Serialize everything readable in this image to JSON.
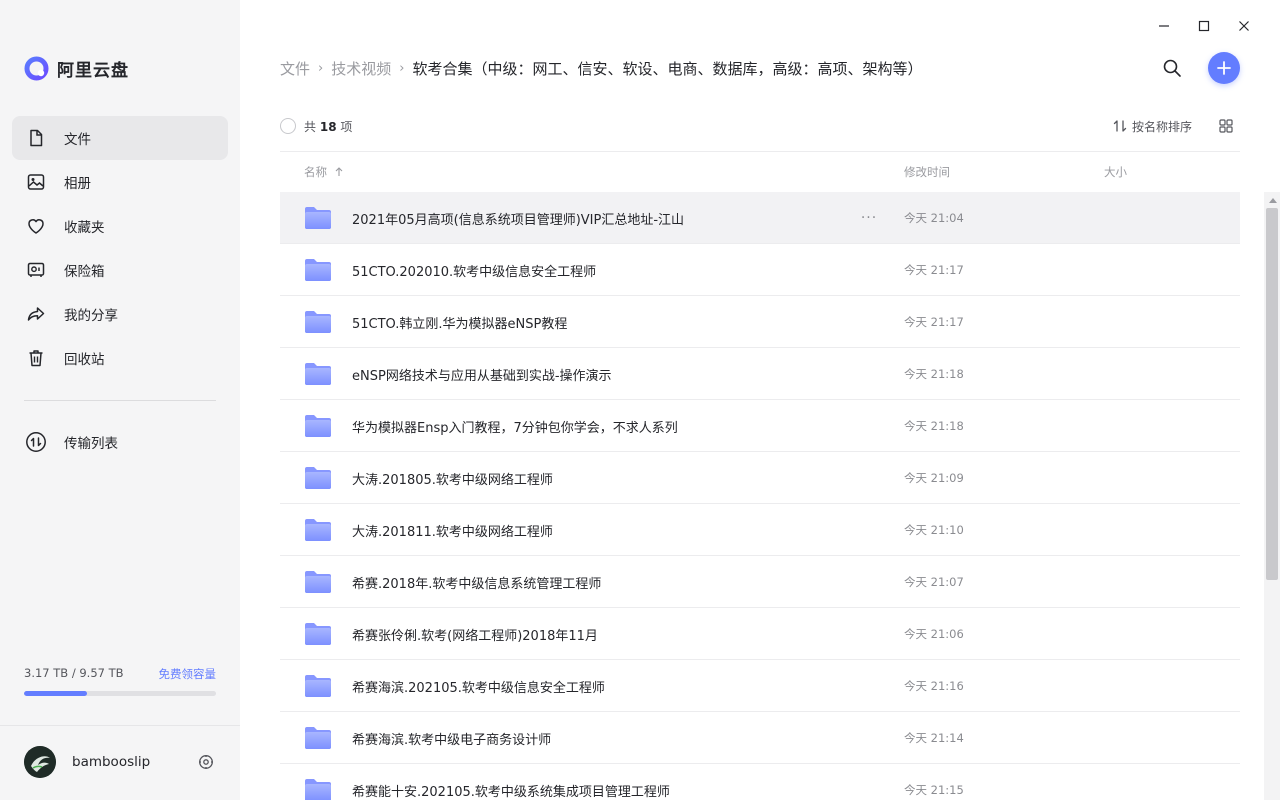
{
  "app": {
    "name": "阿里云盘",
    "accent": "#637dff"
  },
  "sidebar": {
    "nav": [
      {
        "label": "文件",
        "icon": "file-icon",
        "active": true
      },
      {
        "label": "相册",
        "icon": "photo-icon"
      },
      {
        "label": "收藏夹",
        "icon": "heart-icon"
      },
      {
        "label": "保险箱",
        "icon": "safe-icon"
      },
      {
        "label": "我的分享",
        "icon": "share-icon"
      },
      {
        "label": "回收站",
        "icon": "trash-icon"
      }
    ],
    "transfer": {
      "label": "传输列表",
      "icon": "transfer-icon"
    },
    "quota": {
      "used_text": "3.17 TB / 9.57 TB",
      "used_fraction": 0.33,
      "link": "免费领容量"
    },
    "user": {
      "name": "bambooslip"
    }
  },
  "breadcrumb": {
    "items": [
      "文件",
      "技术视频"
    ],
    "current": "软考合集（中级：网工、信安、软设、电商、数据库，高级：高项、架构等）"
  },
  "toolbar": {
    "count_prefix": "共",
    "count": "18",
    "count_suffix": "项",
    "sort_label": "按名称排序"
  },
  "table": {
    "headers": {
      "name": "名称",
      "time": "修改时间",
      "size": "大小"
    },
    "rows": [
      {
        "name": "2021年05月高项(信息系统项目管理师)VIP汇总地址-江山",
        "time": "今天 21:04",
        "hover": true
      },
      {
        "name": "51CTO.202010.软考中级信息安全工程师",
        "time": "今天 21:17"
      },
      {
        "name": "51CTO.韩立刚.华为模拟器eNSP教程",
        "time": "今天 21:17"
      },
      {
        "name": "eNSP网络技术与应用从基础到实战-操作演示",
        "time": "今天 21:18"
      },
      {
        "name": "华为模拟器Ensp入门教程，7分钟包你学会，不求人系列",
        "time": "今天 21:18"
      },
      {
        "name": "大涛.201805.软考中级网络工程师",
        "time": "今天 21:09"
      },
      {
        "name": "大涛.201811.软考中级网络工程师",
        "time": "今天 21:10"
      },
      {
        "name": "希赛.2018年.软考中级信息系统管理工程师",
        "time": "今天 21:07"
      },
      {
        "name": "希赛张伶俐.软考(网络工程师)2018年11月",
        "time": "今天 21:06"
      },
      {
        "name": "希赛海滨.202105.软考中级信息安全工程师",
        "time": "今天 21:16"
      },
      {
        "name": "希赛海滨.软考中级电子商务设计师",
        "time": "今天 21:14"
      },
      {
        "name": "希赛能十安.202105.软考中级系统集成项目管理工程师",
        "time": "今天 21:15"
      }
    ]
  }
}
